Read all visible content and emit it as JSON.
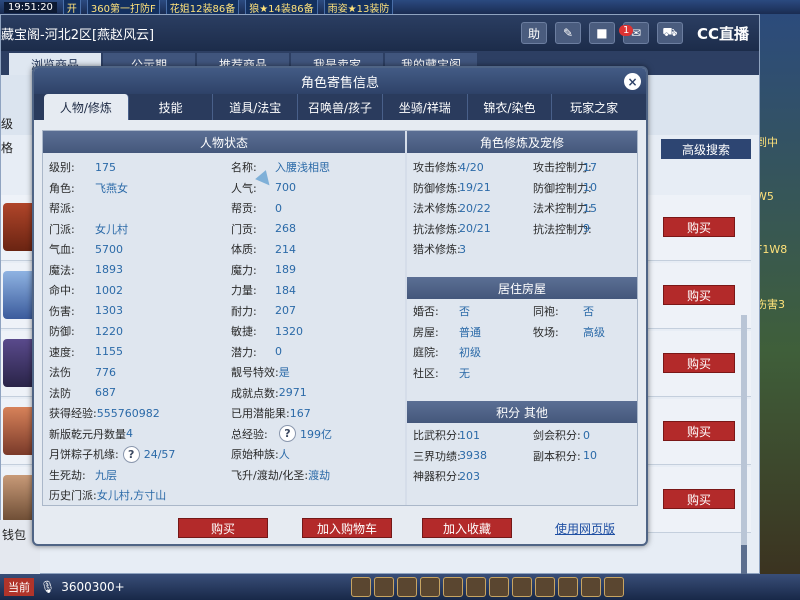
{
  "game": {
    "clock": "19:51:20",
    "banners": [
      "开",
      "360第一打防F",
      "花姐12装86备",
      "狼★14装86备",
      "雨姿★13装防"
    ],
    "channel": "当前",
    "money": "3600300+",
    "right_labels": [
      "到中",
      "W5",
      "F1W8",
      "伤害3"
    ],
    "left_label": "钱包"
  },
  "shop": {
    "title": "藏宝阁-河北2区[燕赵风云]",
    "logo": "CC直播",
    "notification_count": "1",
    "tabs": [
      "浏览商品",
      "公示期",
      "推荐商品",
      "我是卖家",
      "我的藏宝阁"
    ],
    "filter_labels": [
      "级",
      "格"
    ],
    "advanced_search": "高级搜索",
    "buy_label": "购买"
  },
  "modal": {
    "title": "角色寄售信息",
    "close": "×",
    "tabs": [
      "人物/修炼",
      "技能",
      "道具/法宝",
      "召唤兽/孩子",
      "坐骑/祥瑞",
      "锦衣/染色",
      "玩家之家"
    ],
    "status_header": "人物状态",
    "left_col": [
      {
        "k": "级别:",
        "v": "175"
      },
      {
        "k": "角色:",
        "v": "飞燕女"
      },
      {
        "k": "帮派:",
        "v": ""
      },
      {
        "k": "门派:",
        "v": "女儿村"
      },
      {
        "k": "气血:",
        "v": "5700"
      },
      {
        "k": "魔法:",
        "v": "1893"
      },
      {
        "k": "命中:",
        "v": "1002"
      },
      {
        "k": "伤害:",
        "v": "1303"
      },
      {
        "k": "防御:",
        "v": "1220"
      },
      {
        "k": "速度:",
        "v": "1155"
      },
      {
        "k": "法伤",
        "v": "776"
      },
      {
        "k": "法防",
        "v": "687"
      },
      {
        "k": "获得经验:",
        "v": "555760982"
      },
      {
        "k": "新版乾元丹数量",
        "v": "4"
      },
      {
        "k": "月饼粽子机缘:",
        "v": "24/57"
      },
      {
        "k": "生死劫:",
        "v": "九层"
      },
      {
        "k": "历史门派:",
        "v": "女儿村,方寸山"
      }
    ],
    "mid_col": [
      {
        "k": "名称:",
        "v": "入腰浅相思"
      },
      {
        "k": "人气:",
        "v": "700"
      },
      {
        "k": "帮贡:",
        "v": "0"
      },
      {
        "k": "门贡:",
        "v": "268"
      },
      {
        "k": "体质:",
        "v": "214"
      },
      {
        "k": "魔力:",
        "v": "189"
      },
      {
        "k": "力量:",
        "v": "184"
      },
      {
        "k": "耐力:",
        "v": "207"
      },
      {
        "k": "敏捷:",
        "v": "1320"
      },
      {
        "k": "潜力:",
        "v": "0"
      },
      {
        "k": "靓号特效:",
        "v": "是"
      },
      {
        "k": "成就点数:",
        "v": "2971"
      },
      {
        "k": "已用潜能果:",
        "v": "167"
      },
      {
        "k": "总经验:",
        "v": "199亿"
      },
      {
        "k": "原始种族:",
        "v": "人"
      },
      {
        "k": "飞升/渡劫/化圣:",
        "v": "渡劫"
      }
    ],
    "cultivation_header": "角色修炼及宠修",
    "cultivation": [
      {
        "k": "攻击修炼:",
        "v": "4/20",
        "k2": "攻击控制力:",
        "v2": "17"
      },
      {
        "k": "防御修炼:",
        "v": "19/21",
        "k2": "防御控制力:",
        "v2": "10"
      },
      {
        "k": "法术修炼:",
        "v": "20/22",
        "k2": "法术控制力:",
        "v2": "15"
      },
      {
        "k": "抗法修炼:",
        "v": "20/21",
        "k2": "抗法控制力:",
        "v2": "9"
      },
      {
        "k": "猎术修炼:",
        "v": "3",
        "k2": "",
        "v2": ""
      }
    ],
    "housing_header": "居住房屋",
    "housing": [
      {
        "k": "婚否:",
        "v": "否",
        "k2": "同袍:",
        "v2": "否"
      },
      {
        "k": "房屋:",
        "v": "普通",
        "k2": "牧场:",
        "v2": "高级"
      },
      {
        "k": "庭院:",
        "v": "初级",
        "k2": "",
        "v2": ""
      },
      {
        "k": "社区:",
        "v": "无",
        "k2": "",
        "v2": ""
      }
    ],
    "points_header": "积分 其他",
    "points": [
      {
        "k": "比武积分:",
        "v": "101",
        "k2": "剑会积分:",
        "v2": "0"
      },
      {
        "k": "三界功绩:",
        "v": "3938",
        "k2": "副本积分:",
        "v2": "10"
      },
      {
        "k": "神器积分:",
        "v": "203",
        "k2": "",
        "v2": ""
      }
    ],
    "buttons": {
      "buy": "购买",
      "cart": "加入购物车",
      "fav": "加入收藏",
      "web": "使用网页版"
    },
    "help_glyph": "?"
  },
  "colors": {
    "buy_red": "#b32a2a",
    "header_navy": "#2a3b5d",
    "value_blue": "#2b6aa8"
  }
}
